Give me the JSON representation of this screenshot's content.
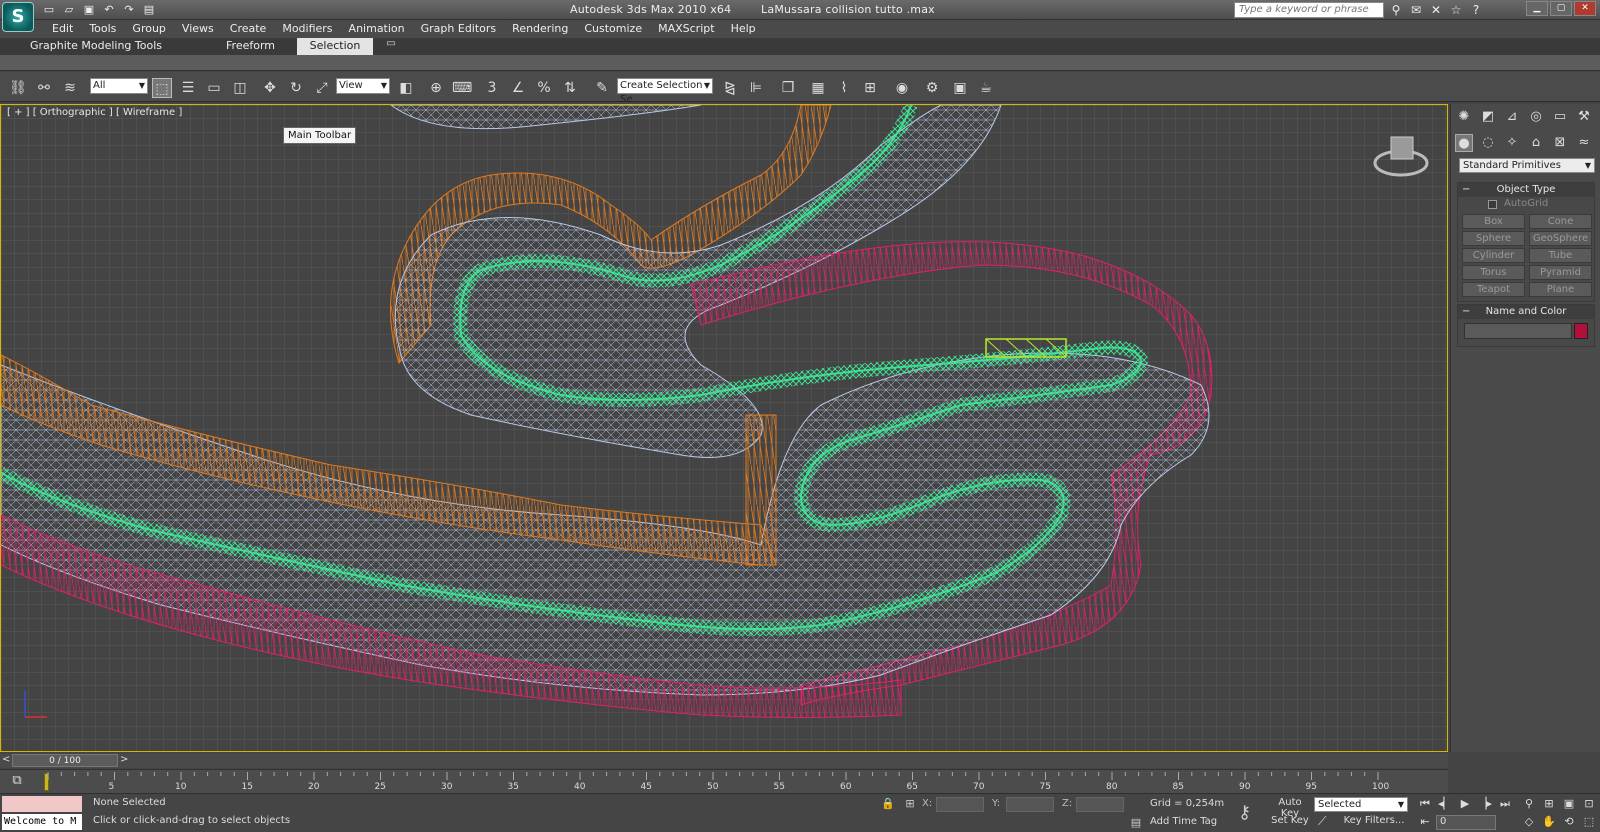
{
  "window": {
    "app_title": "Autodesk 3ds Max  2010 x64",
    "file_title": "LaMussara collision tutto .max",
    "logo_glyph": "S",
    "help_search_placeholder": "Type a keyword or phrase",
    "controls": [
      "minimize-icon",
      "maximize-icon",
      "close-icon"
    ]
  },
  "quick_access": [
    "new-file-icon",
    "open-file-icon",
    "save-icon",
    "undo-icon",
    "redo-icon",
    "project-folder-icon"
  ],
  "menu": [
    "Edit",
    "Tools",
    "Group",
    "Views",
    "Create",
    "Modifiers",
    "Animation",
    "Graph Editors",
    "Rendering",
    "Customize",
    "MAXScript",
    "Help"
  ],
  "ribbon": {
    "tabs": [
      {
        "label": "Graphite Modeling Tools",
        "active": false
      },
      {
        "label": "Freeform",
        "active": false
      },
      {
        "label": "Selection",
        "active": true
      }
    ]
  },
  "toolbar": {
    "selection_filter": "All",
    "reference_coord": "View",
    "named_selection": "Create Selection Se",
    "tooltip": "Main Toolbar"
  },
  "viewport": {
    "label": "[ + ] [ Orthographic ] [ Wireframe ]",
    "colors": {
      "grid": "#5a5a5a",
      "mesh": "#b8c8e8",
      "orange": "#e07a20",
      "green": "#3ee898",
      "magenta": "#e0206a",
      "lime": "#b6e828",
      "border": "#d6b800"
    }
  },
  "command_panel": {
    "dropdown": "Standard Primitives",
    "object_type": {
      "title": "Object Type",
      "autogrid": "AutoGrid",
      "buttons": [
        "Box",
        "Cone",
        "Sphere",
        "GeoSphere",
        "Cylinder",
        "Tube",
        "Torus",
        "Pyramid",
        "Teapot",
        "Plane"
      ]
    },
    "name_and_color": {
      "title": "Name and Color",
      "color": "#b0103a"
    }
  },
  "time_slider": {
    "frame": "0 / 100",
    "ticks": [
      "5",
      "10",
      "15",
      "20",
      "25",
      "30",
      "35",
      "40",
      "45",
      "50",
      "55",
      "60",
      "65",
      "70",
      "75",
      "80",
      "85",
      "90",
      "95",
      "100"
    ]
  },
  "status": {
    "selected": "None Selected",
    "prompt": "Click or click-and-drag to select objects",
    "maxscript": "Welcome to M",
    "x_label": "X:",
    "y_label": "Y:",
    "z_label": "Z:",
    "grid": "Grid = 0,254m",
    "add_time_tag": "Add Time Tag",
    "auto_key": "Auto Key",
    "set_key": "Set Key",
    "key_mode": "Selected",
    "key_filters": "Key Filters...",
    "current_frame": "0"
  }
}
